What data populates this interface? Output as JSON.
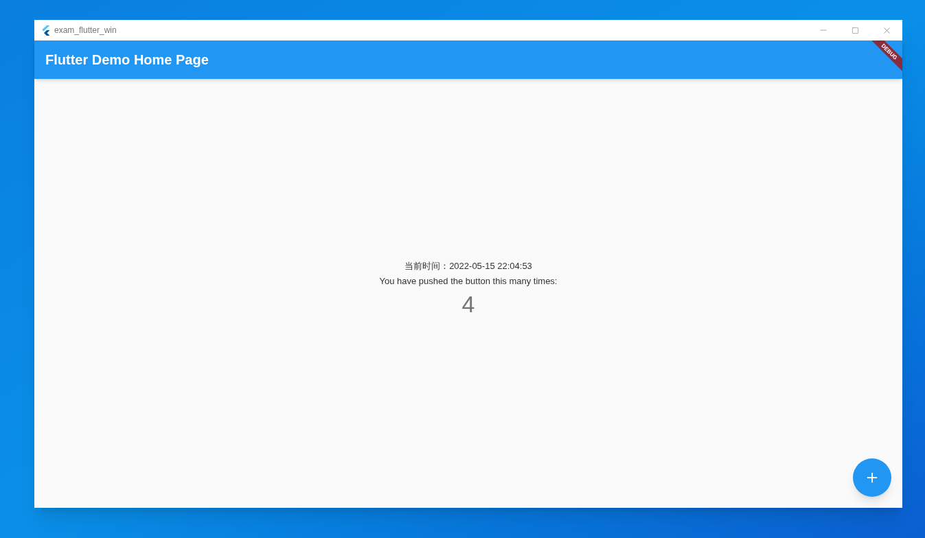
{
  "window": {
    "title": "exam_flutter_win"
  },
  "app_bar": {
    "title": "Flutter Demo Home Page",
    "banner": "DEBUG"
  },
  "body": {
    "time_line": "当前时间：2022-05-15 22:04:53",
    "message": "You have pushed the button this many times:",
    "counter": "4"
  }
}
